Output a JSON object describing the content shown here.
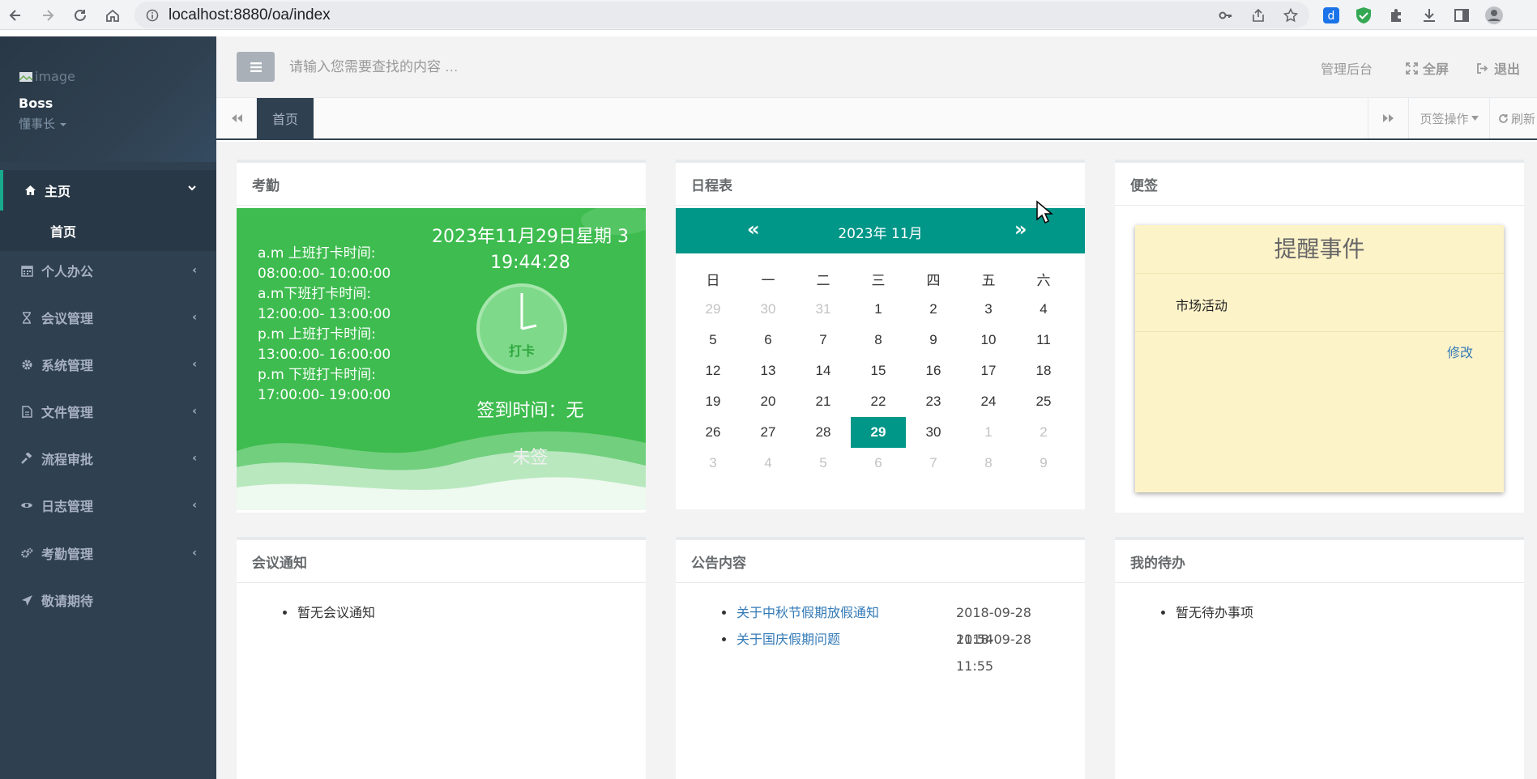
{
  "browser": {
    "url": "localhost:8880/oa/index"
  },
  "sidebar": {
    "profile_image_alt": "image",
    "user_name": "Boss",
    "user_role": "懂事长",
    "menu": [
      {
        "label": "主页",
        "icon": "home-icon",
        "expanded": true
      },
      {
        "label": "个人办公",
        "icon": "calendar-icon"
      },
      {
        "label": "会议管理",
        "icon": "hourglass-icon"
      },
      {
        "label": "系统管理",
        "icon": "gear-icon"
      },
      {
        "label": "文件管理",
        "icon": "file-icon"
      },
      {
        "label": "流程审批",
        "icon": "gavel-icon"
      },
      {
        "label": "日志管理",
        "icon": "eye-icon"
      },
      {
        "label": "考勤管理",
        "icon": "gears-icon"
      },
      {
        "label": "敬请期待",
        "icon": "plane-icon"
      }
    ],
    "submenu_home": "首页"
  },
  "topbar": {
    "search_placeholder": "请输入您需要查找的内容 …",
    "admin_label": "管理后台",
    "fullscreen_label": "全屏",
    "logout_label": "退出"
  },
  "tabs": {
    "active_tab": "首页",
    "ops_label": "页签操作",
    "refresh_label": "刷新"
  },
  "attendance": {
    "title": "考勤",
    "times": [
      "a.m 上班打卡时间:",
      "08:00:00- 10:00:00",
      "a.m下班打卡时间:",
      "12:00:00- 13:00:00",
      "p.m 上班打卡时间:",
      "13:00:00- 16:00:00",
      "p.m 下班打卡时间:",
      "17:00:00- 19:00:00"
    ],
    "date_line": "2023年11月29日星期 3",
    "time_line": "19:44:28",
    "punch_label": "打卡",
    "sign_time": "签到时间：无",
    "status": "未签"
  },
  "calendar": {
    "title": "日程表",
    "prev": "«",
    "next": "»",
    "month_title": "2023年   11月",
    "weekdays": [
      "日",
      "一",
      "二",
      "三",
      "四",
      "五",
      "六"
    ],
    "weeks": [
      [
        {
          "d": "29",
          "m": true
        },
        {
          "d": "30",
          "m": true
        },
        {
          "d": "31",
          "m": true
        },
        {
          "d": "1"
        },
        {
          "d": "2"
        },
        {
          "d": "3"
        },
        {
          "d": "4"
        }
      ],
      [
        {
          "d": "5"
        },
        {
          "d": "6"
        },
        {
          "d": "7"
        },
        {
          "d": "8"
        },
        {
          "d": "9"
        },
        {
          "d": "10"
        },
        {
          "d": "11"
        }
      ],
      [
        {
          "d": "12"
        },
        {
          "d": "13"
        },
        {
          "d": "14"
        },
        {
          "d": "15"
        },
        {
          "d": "16"
        },
        {
          "d": "17"
        },
        {
          "d": "18"
        }
      ],
      [
        {
          "d": "19"
        },
        {
          "d": "20"
        },
        {
          "d": "21"
        },
        {
          "d": "22"
        },
        {
          "d": "23"
        },
        {
          "d": "24"
        },
        {
          "d": "25"
        }
      ],
      [
        {
          "d": "26"
        },
        {
          "d": "27"
        },
        {
          "d": "28"
        },
        {
          "d": "29",
          "t": true
        },
        {
          "d": "30"
        },
        {
          "d": "1",
          "m": true
        },
        {
          "d": "2",
          "m": true
        }
      ],
      [
        {
          "d": "3",
          "m": true
        },
        {
          "d": "4",
          "m": true
        },
        {
          "d": "5",
          "m": true
        },
        {
          "d": "6",
          "m": true
        },
        {
          "d": "7",
          "m": true
        },
        {
          "d": "8",
          "m": true
        },
        {
          "d": "9",
          "m": true
        }
      ]
    ]
  },
  "note": {
    "title": "便签",
    "card_title": "提醒事件",
    "content": "市场活动",
    "edit_label": "修改"
  },
  "meetings": {
    "title": "会议通知",
    "items": [
      "暂无会议通知"
    ]
  },
  "notices": {
    "title": "公告内容",
    "items": [
      {
        "title": "关于中秋节假期放假通知",
        "time": "2018-09-28 11:54"
      },
      {
        "title": "关于国庆假期问题",
        "time": "2018-09-28 11:55"
      }
    ]
  },
  "todos": {
    "title": "我的待办",
    "items": [
      "暂无待办事项"
    ]
  }
}
